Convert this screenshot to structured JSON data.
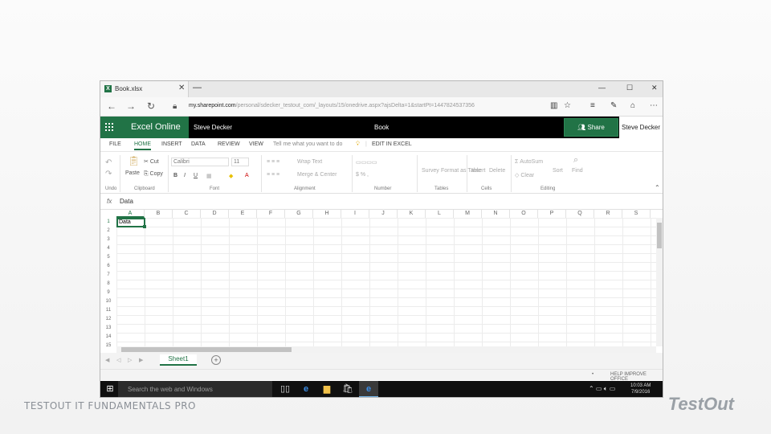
{
  "branding": {
    "left": "TESTOUT IT FUNDAMENTALS PRO",
    "right": "TestOut"
  },
  "browser": {
    "tab_title": "Book.xlsx",
    "tab_icon": "X",
    "url_domain": "my.sharepoint.com",
    "url_path": "/personal/sdecker_testout_com/_layouts/15/onedrive.aspx?ajsDelta=1&startPt=1447824537356"
  },
  "excel": {
    "app_name": "Excel Online",
    "user": "Steve Decker",
    "book_name": "Book",
    "share_label": "Share",
    "user_right": "Steve Decker"
  },
  "ribbon": {
    "tabs": [
      "FILE",
      "HOME",
      "INSERT",
      "DATA",
      "REVIEW",
      "VIEW"
    ],
    "active_tab": "HOME",
    "tell_me": "Tell me what you want to do",
    "edit_in_excel": "EDIT IN EXCEL",
    "paste": "Paste",
    "cut": "Cut",
    "copy": "Copy",
    "font_name": "Calibri",
    "font_size": "11",
    "bold": "B",
    "italic": "I",
    "underline": "U",
    "wrap_text": "Wrap Text",
    "merge_center": "Merge & Center",
    "survey": "Survey",
    "format_as_table": "Format as Table",
    "insert": "Insert",
    "delete": "Delete",
    "autosum": "AutoSum",
    "clear": "Clear",
    "sort": "Sort",
    "find": "Find",
    "groups": [
      "Undo",
      "Clipboard",
      "Font",
      "Alignment",
      "Number",
      "Tables",
      "Cells",
      "Editing"
    ]
  },
  "formula_bar": {
    "fx": "fx",
    "value": "Data"
  },
  "grid": {
    "columns": [
      "A",
      "B",
      "C",
      "D",
      "E",
      "F",
      "G",
      "H",
      "I",
      "J",
      "K",
      "L",
      "M",
      "N",
      "O",
      "P",
      "Q",
      "R",
      "S"
    ],
    "rows": [
      "1",
      "2",
      "3",
      "4",
      "5",
      "6",
      "7",
      "8",
      "9",
      "10",
      "11",
      "12",
      "13",
      "14",
      "15"
    ],
    "active_cell_value": "Data"
  },
  "sheets": {
    "tabs": [
      "Sheet1"
    ],
    "add": "+"
  },
  "status": {
    "text": "HELP IMPROVE OFFICE"
  },
  "taskbar": {
    "search_placeholder": "Search the web and Windows",
    "clock_time": "10:03 AM",
    "clock_date": "7/9/2016"
  }
}
